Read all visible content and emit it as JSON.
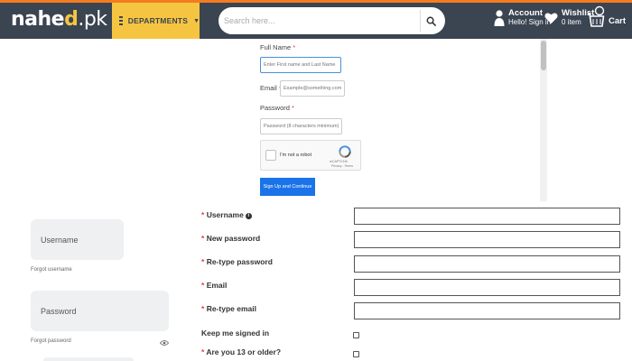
{
  "header": {
    "logo_part1": "nahe",
    "logo_part2": "d",
    "logo_part3": ".pk",
    "departments_label": "DEPARTMENTS",
    "search_placeholder": "Search here...",
    "account_title": "Account",
    "account_sub": "Hello! Sign in",
    "wishlist_title": "Wishlist",
    "wishlist_sub": "0 item",
    "cart_title": "Cart",
    "colors": {
      "header_bg": "#3b4451",
      "accent": "#f47b20",
      "departments_bg": "#f5c542"
    }
  },
  "signup": {
    "fullname_label": "Full Name",
    "fullname_placeholder": "Enter First name and Last Name",
    "email_label": "Email",
    "email_placeholder": "Example@something.com",
    "password_label": "Password",
    "password_placeholder": "Password (8 characters minimum)",
    "recaptcha_label": "I'm not a robot",
    "recaptcha_brand": "reCAPTCHA",
    "recaptcha_links": "Privacy - Terms",
    "submit_label": "Sign Up and Continue",
    "colors": {
      "button": "#1a73e8"
    }
  },
  "login": {
    "username_placeholder": "Username",
    "forgot_username": "Forgot username",
    "password_placeholder": "Password",
    "forgot_password": "Forgot password"
  },
  "register": {
    "username_label": "Username",
    "new_password_label": "New password",
    "retype_password_label": "Re-type password",
    "email_label": "Email",
    "retype_email_label": "Re-type email",
    "keep_signed_label": "Keep me signed in",
    "age_label": "Are you 13 or older?",
    "required_mark": "*"
  },
  "icons": [
    "menu-icon",
    "chevron-down-icon",
    "search-icon",
    "user-icon",
    "heart-icon",
    "cart-icon",
    "recaptcha-icon",
    "info-icon",
    "eye-icon"
  ]
}
